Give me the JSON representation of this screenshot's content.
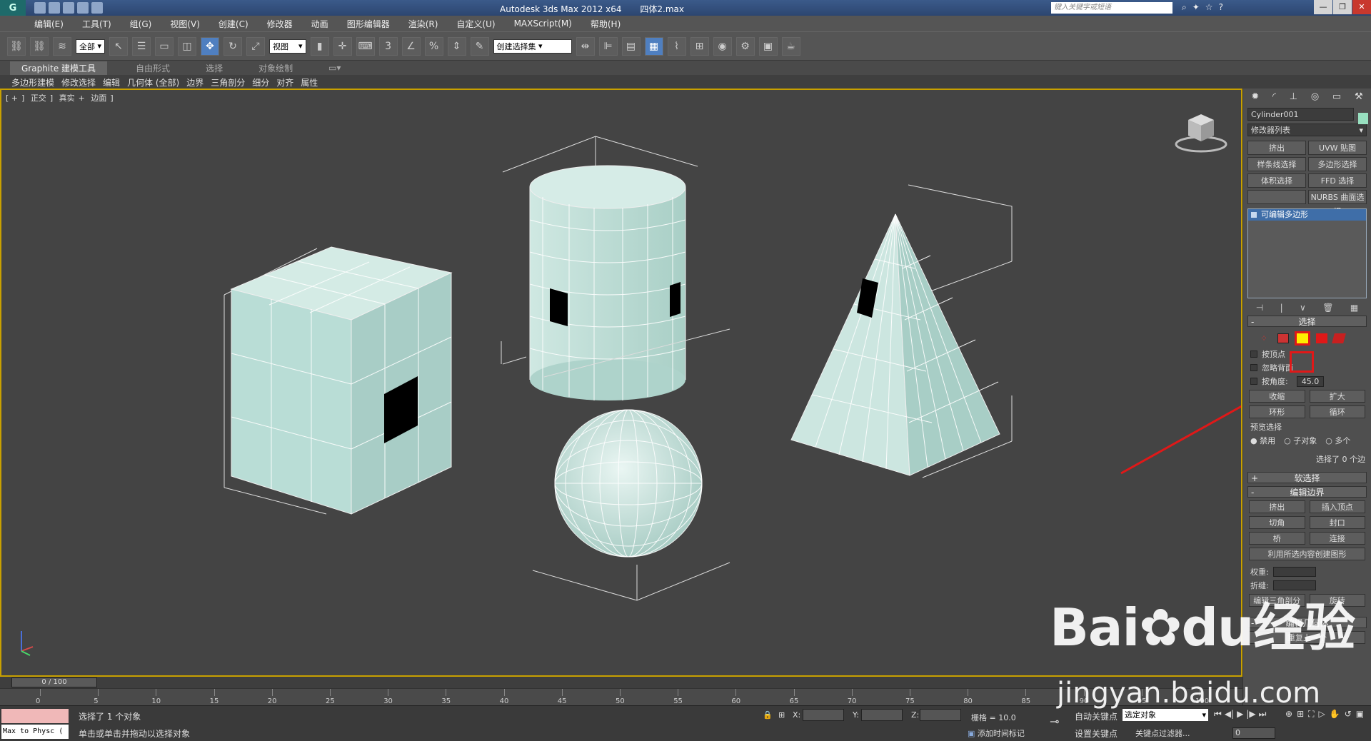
{
  "window": {
    "logo_glyph": "G",
    "app_title": "Autodesk 3ds Max  2012 x64",
    "file_name": "四体2.max",
    "search_placeholder": "键入关键字或短语",
    "minimize": "—",
    "restore": "❐",
    "close": "✕"
  },
  "menu": [
    "编辑(E)",
    "工具(T)",
    "组(G)",
    "视图(V)",
    "创建(C)",
    "修改器",
    "动画",
    "图形编辑器",
    "渲染(R)",
    "自定义(U)",
    "MAXScript(M)",
    "帮助(H)"
  ],
  "toolbar": {
    "filter_value": "全部",
    "refcoord_value": "视图",
    "named_selection_value": "创建选择集",
    "snap_3": "3",
    "percent_snap": "%"
  },
  "ribbon": {
    "tabs": [
      "Graphite 建模工具",
      "自由形式",
      "选择",
      "对象绘制"
    ],
    "sub": [
      "多边形建模",
      "修改选择",
      "编辑",
      "几何体 (全部)",
      "边界",
      "三角剖分",
      "细分",
      "对齐",
      "属性"
    ]
  },
  "viewport": {
    "label": [
      "[ +",
      "]",
      "正交",
      "]",
      "真实",
      "+",
      "边面",
      "]"
    ]
  },
  "cmdpanel": {
    "object_name": "Cylinder001",
    "modifier_list": "修改器列表",
    "buttons": [
      "挤出",
      "UVW 贴图",
      "样条线选择",
      "多边形选择",
      "体积选择",
      "FFD 选择",
      "",
      "NURBS 曲面选择"
    ],
    "stack_item": "可编辑多边形",
    "selection_title": "选择",
    "by_vertex": "按顶点",
    "ignore_backface": "忽略背面",
    "by_angle": "按角度:",
    "angle_value": "45.0",
    "shrink": "收缩",
    "grow": "扩大",
    "ring": "环形",
    "loop": "循环",
    "preview_title": "预览选择",
    "radio_disable": "禁用",
    "radio_subobj": "子对象",
    "radio_multi": "多个",
    "selected_count": "选择了 0 个边",
    "soft_sel_title": "软选择",
    "edit_border_title": "编辑边界",
    "extrude": "挤出",
    "insert_vertex": "插入顶点",
    "chamfer": "切角",
    "cap": "封口",
    "bridge": "桥",
    "connect": "连接",
    "create_shape": "利用所选内容创建图形",
    "weight": "权重:",
    "crease": "折缝:",
    "edit_tri": "编辑三角剖分",
    "turn": "旋转",
    "edit_geo_title": "编辑几何体",
    "repeat_last": "重复上一个"
  },
  "timeline": {
    "thumb": "0 / 100",
    "ticks": [
      "0",
      "5",
      "10",
      "15",
      "20",
      "25",
      "30",
      "35",
      "40",
      "45",
      "50",
      "55",
      "60",
      "65",
      "70",
      "75",
      "80",
      "85",
      "90",
      "95",
      "100"
    ]
  },
  "status": {
    "maxscript_text": "Max to Physc (",
    "line1": "选择了 1 个对象",
    "line2": "单击或单击并拖动以选择对象",
    "x_label": "X:",
    "y_label": "Y:",
    "z_label": "Z:",
    "grid": "栅格 = 10.0",
    "add_time_tag": "添加时间标记",
    "auto_key": "自动关键点",
    "set_key": "设置关键点",
    "key_mode": "选定对象",
    "key_filters": "关键点过滤器...",
    "frame": "0"
  },
  "watermark": {
    "brand": "Bai",
    "brand2": "du",
    "brand3": "经验",
    "url": "jingyan.baidu.com"
  },
  "colors": {
    "object_fill": "#b8ddd5",
    "wire": "#e8e8e8",
    "highlight_red": "#e01818",
    "accent_blue": "#3f6ea8"
  }
}
